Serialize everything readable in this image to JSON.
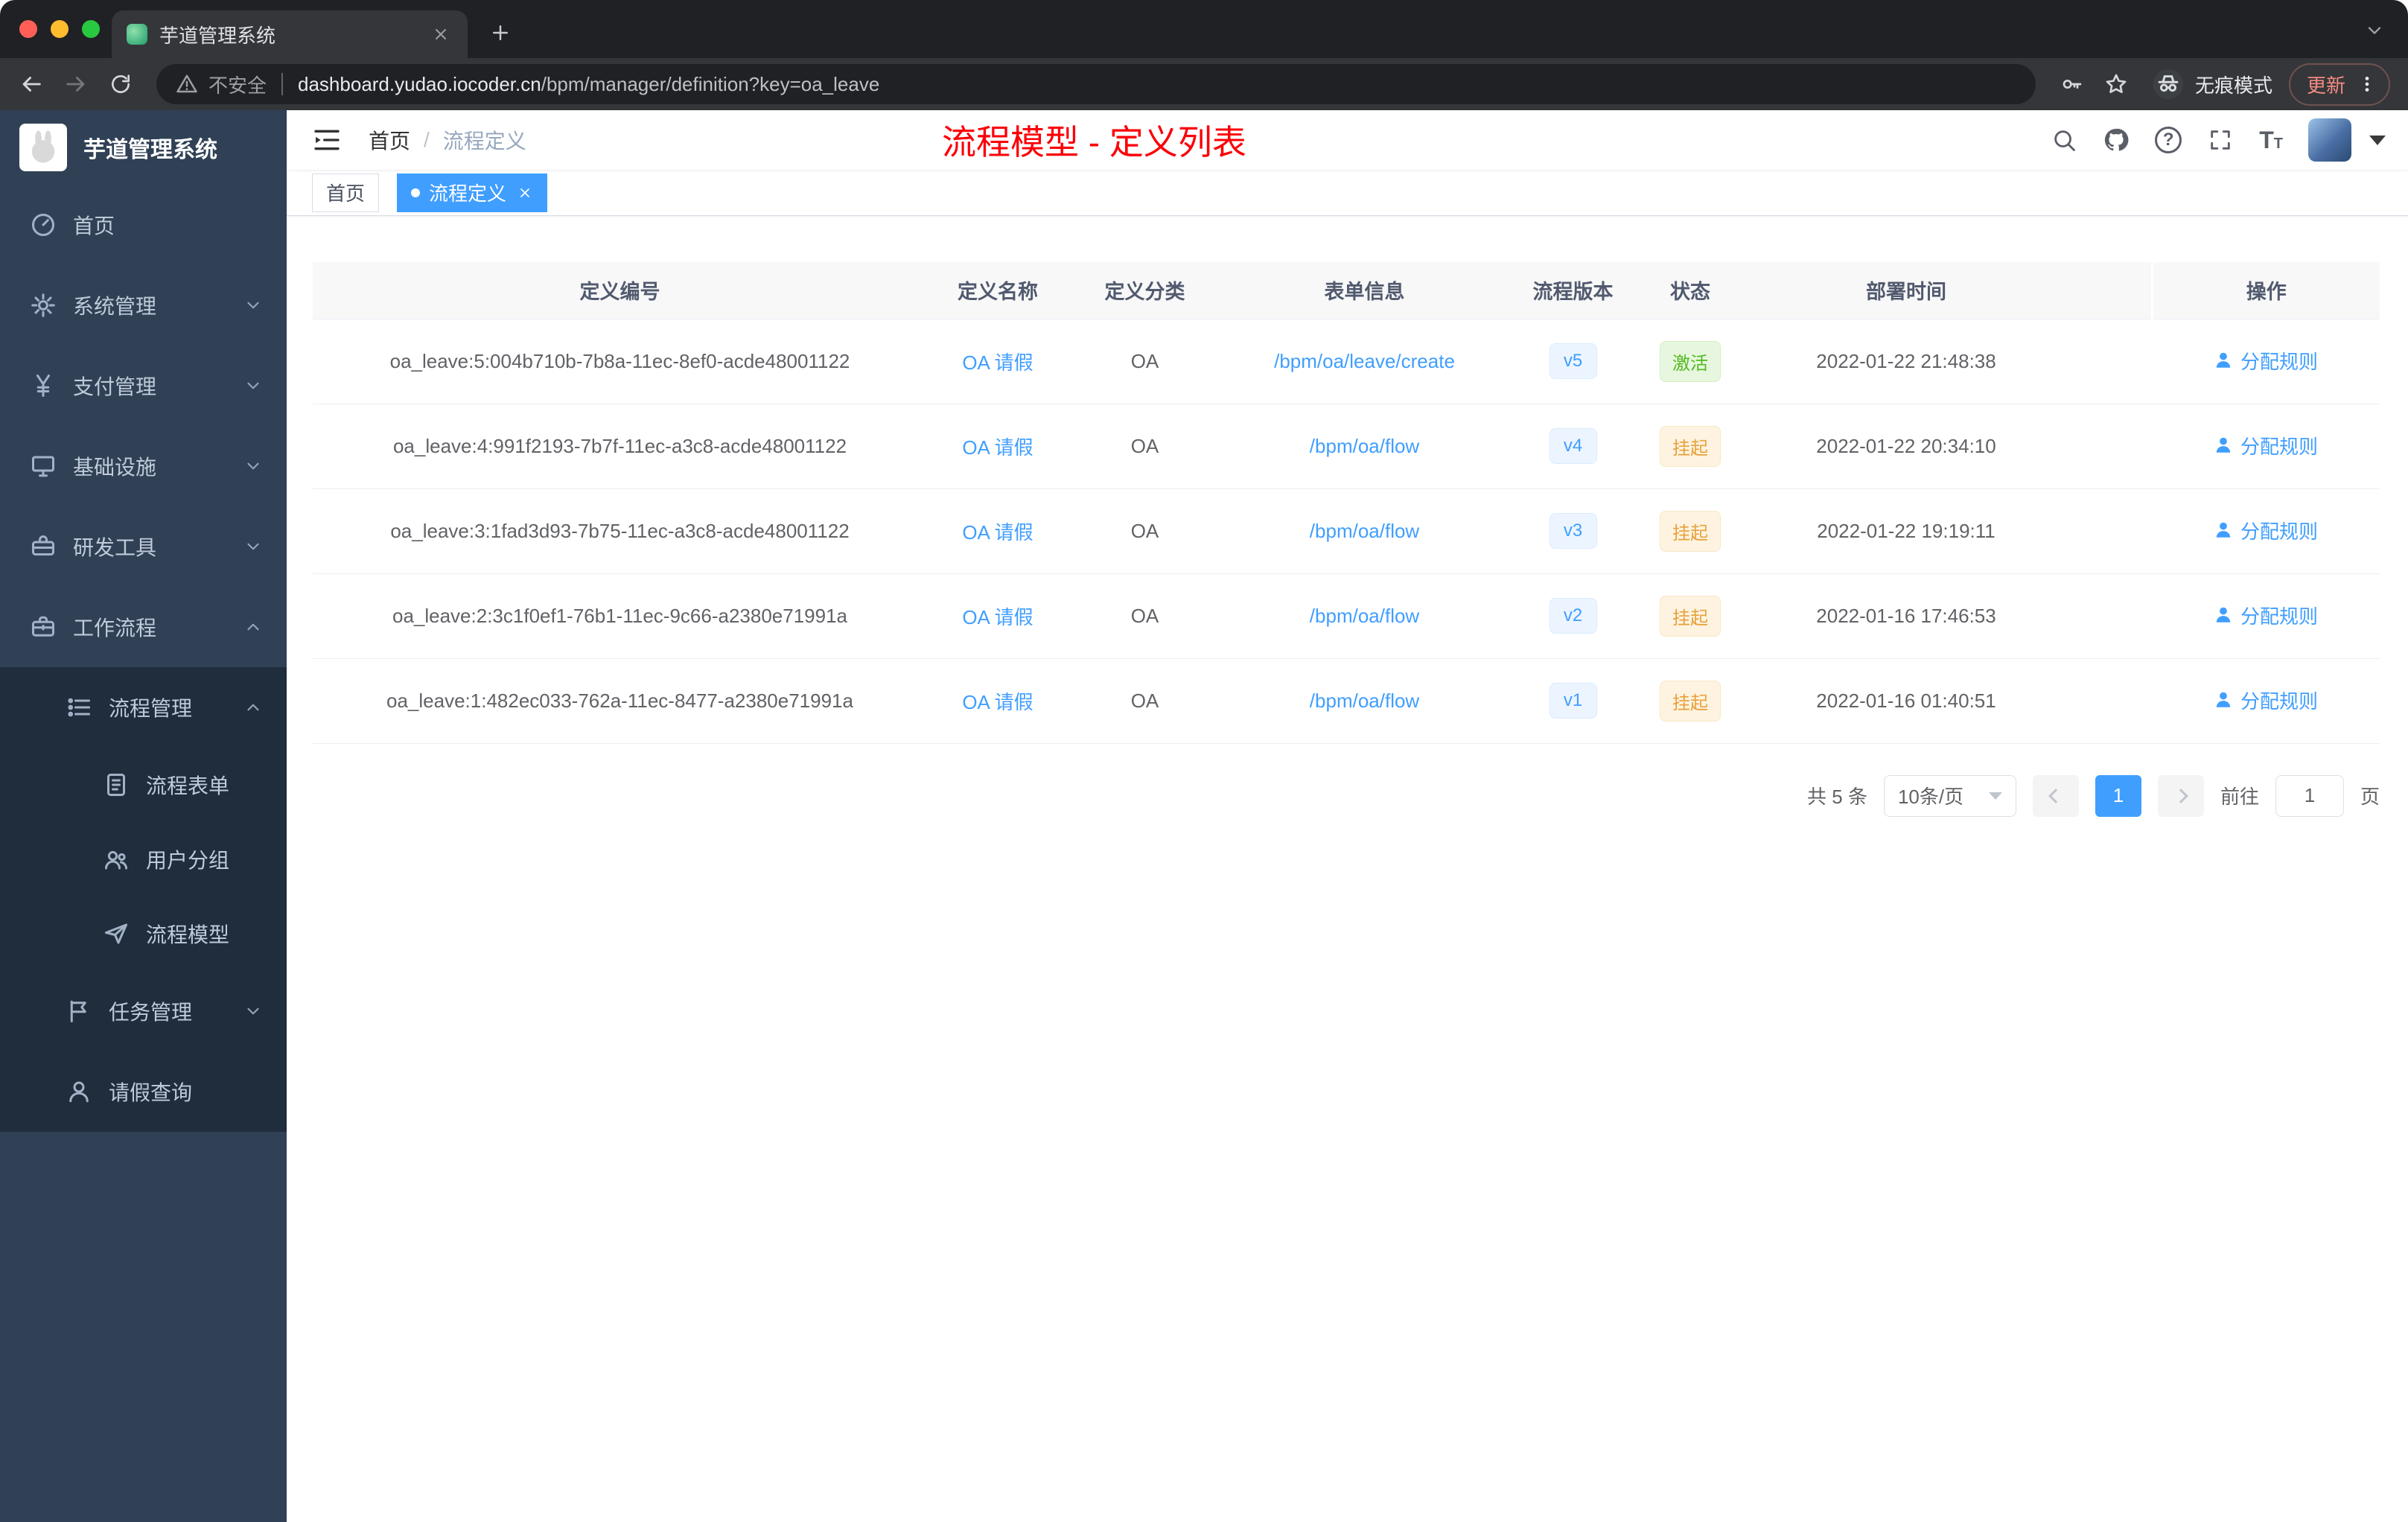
{
  "colors": {
    "accent_blue": "#409eff",
    "annotation_red": "#fb0007",
    "status_active_green": "#52b91e",
    "status_suspend_orange": "#e6a23c",
    "sidebar_bg": "#304156",
    "submenu_bg": "#1f2d3d"
  },
  "browser": {
    "tab": {
      "title": "芋道管理系统"
    },
    "address": {
      "security_label": "不安全",
      "url_host": "dashboard.yudao.iocoder.cn",
      "url_path": "/bpm/manager/definition?key=oa_leave"
    },
    "incognito_label": "无痕模式",
    "update_label": "更新"
  },
  "sidebar": {
    "logo_title": "芋道管理系统",
    "items": [
      {
        "label": "首页",
        "icon": "dashboard-icon"
      },
      {
        "label": "系统管理",
        "icon": "gear-icon",
        "state": "collapsed"
      },
      {
        "label": "支付管理",
        "icon": "yen-icon",
        "state": "collapsed"
      },
      {
        "label": "基础设施",
        "icon": "monitor-icon",
        "state": "collapsed"
      },
      {
        "label": "研发工具",
        "icon": "toolbox-icon",
        "state": "collapsed"
      },
      {
        "label": "工作流程",
        "icon": "briefcase-icon",
        "state": "expanded"
      },
      {
        "label": "流程管理",
        "icon": "list-icon",
        "state": "expanded"
      },
      {
        "label": "流程表单",
        "icon": "form-icon"
      },
      {
        "label": "用户分组",
        "icon": "user-group-icon"
      },
      {
        "label": "流程模型",
        "icon": "paper-plane-icon"
      },
      {
        "label": "任务管理",
        "icon": "task-icon",
        "state": "collapsed"
      },
      {
        "label": "请假查询",
        "icon": "person-icon"
      }
    ]
  },
  "header": {
    "breadcrumb": {
      "home": "首页",
      "separator": "/",
      "current": "流程定义"
    },
    "annotation": "流程模型 - 定义列表"
  },
  "tags": {
    "home": "首页",
    "active": "流程定义"
  },
  "table": {
    "columns": [
      "定义编号",
      "定义名称",
      "定义分类",
      "表单信息",
      "流程版本",
      "状态",
      "部署时间",
      "操作"
    ],
    "action_label": "分配规则",
    "rows": [
      {
        "id": "oa_leave:5:004b710b-7b8a-11ec-8ef0-acde48001122",
        "name": "OA 请假",
        "category": "OA",
        "form": "/bpm/oa/leave/create",
        "version": "v5",
        "status": "激活",
        "time": "2022-01-22 21:48:38"
      },
      {
        "id": "oa_leave:4:991f2193-7b7f-11ec-a3c8-acde48001122",
        "name": "OA 请假",
        "category": "OA",
        "form": "/bpm/oa/flow",
        "version": "v4",
        "status": "挂起",
        "time": "2022-01-22 20:34:10"
      },
      {
        "id": "oa_leave:3:1fad3d93-7b75-11ec-a3c8-acde48001122",
        "name": "OA 请假",
        "category": "OA",
        "form": "/bpm/oa/flow",
        "version": "v3",
        "status": "挂起",
        "time": "2022-01-22 19:19:11"
      },
      {
        "id": "oa_leave:2:3c1f0ef1-76b1-11ec-9c66-a2380e71991a",
        "name": "OA 请假",
        "category": "OA",
        "form": "/bpm/oa/flow",
        "version": "v2",
        "status": "挂起",
        "time": "2022-01-16 17:46:53"
      },
      {
        "id": "oa_leave:1:482ec033-762a-11ec-8477-a2380e71991a",
        "name": "OA 请假",
        "category": "OA",
        "form": "/bpm/oa/flow",
        "version": "v1",
        "status": "挂起",
        "time": "2022-01-16 01:40:51"
      }
    ]
  },
  "pagination": {
    "total": "共 5 条",
    "page_size": "10条/页",
    "current_page": "1",
    "goto_label": "前往",
    "goto_value": "1",
    "goto_suffix": "页"
  }
}
